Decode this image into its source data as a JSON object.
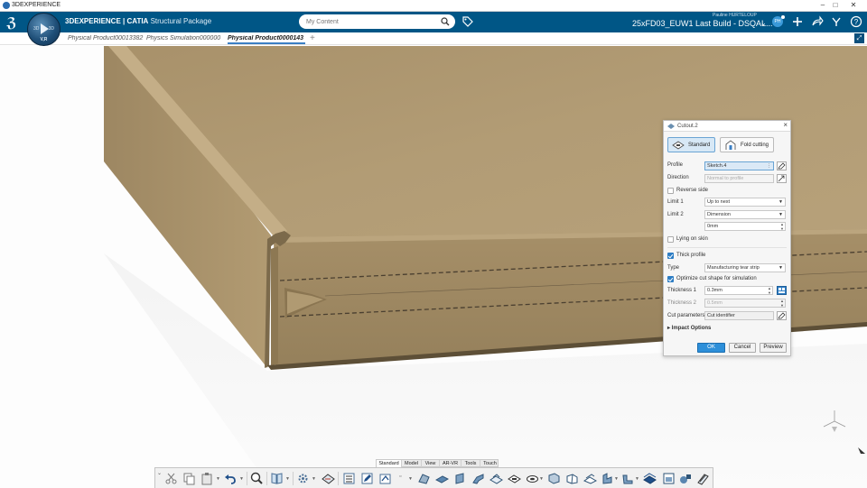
{
  "os_window": {
    "title": "3DEXPERIENCE",
    "controls": [
      "–",
      "□",
      "✕"
    ]
  },
  "app_header": {
    "logo": "ℨ",
    "compass": {
      "left": "3D",
      "right": "3D",
      "version": "V,R"
    },
    "brand_bold": "3DEXPERIENCE | CATIA",
    "brand_package": "Structural Package",
    "search_placeholder": "My Content",
    "user_name": "Pauline HURTELOUP",
    "context": "25xFD03_EUW1 Last Build - DSQAL...",
    "avatar_initials": "PH",
    "icons": [
      "tag-icon",
      "add-icon",
      "share-icon",
      "tools-icon",
      "help-icon"
    ]
  },
  "tabs": [
    {
      "label": "Physical Product00013382",
      "active": false
    },
    {
      "label": "Physics Simulation000000",
      "active": false
    },
    {
      "label": "Physical Product0000143",
      "active": true
    }
  ],
  "tab_add": "+",
  "dialog": {
    "title": "Cutout.2",
    "modes": {
      "standard": "Standard",
      "fold_cutting": "Fold cutting"
    },
    "profile": {
      "label": "Profile",
      "value": "Sketch.4"
    },
    "direction": {
      "label": "Direction",
      "placeholder": "Normal to profile"
    },
    "reverse_side": {
      "label": "Reverse side",
      "checked": false
    },
    "limit1": {
      "label": "Limit 1",
      "value": "Up to next"
    },
    "limit2": {
      "label": "Limit 2",
      "value": "Dimension"
    },
    "limit2_value": "0mm",
    "lying_on_skin": {
      "label": "Lying on skin",
      "checked": false
    },
    "thick_profile": {
      "label": "Thick profile",
      "checked": true
    },
    "type": {
      "label": "Type",
      "value": "Manufacturing tear strip"
    },
    "optimize": {
      "label": "Optimize cut shape for simulation",
      "checked": true
    },
    "thickness1": {
      "label": "Thickness 1",
      "value": "0.3mm"
    },
    "thickness2": {
      "label": "Thickness 2",
      "value": "0.5mm"
    },
    "cut_parameters": {
      "label": "Cut parameters",
      "value": "Cut identifier"
    },
    "impact_options": "Impact Options",
    "buttons": {
      "ok": "OK",
      "cancel": "Cancel",
      "preview": "Preview"
    }
  },
  "section_tabs": [
    {
      "label": "Standard",
      "active": true
    },
    {
      "label": "Model",
      "active": false
    },
    {
      "label": "View",
      "active": false
    },
    {
      "label": "AR-VR",
      "active": false
    },
    {
      "label": "Tools",
      "active": false
    },
    {
      "label": "Touch",
      "active": false
    }
  ],
  "colors": {
    "header_bg": "#005686",
    "accent": "#2d8fd9",
    "model_top": "#b19b74",
    "model_front": "#9c8660",
    "model_side": "#a89167"
  }
}
